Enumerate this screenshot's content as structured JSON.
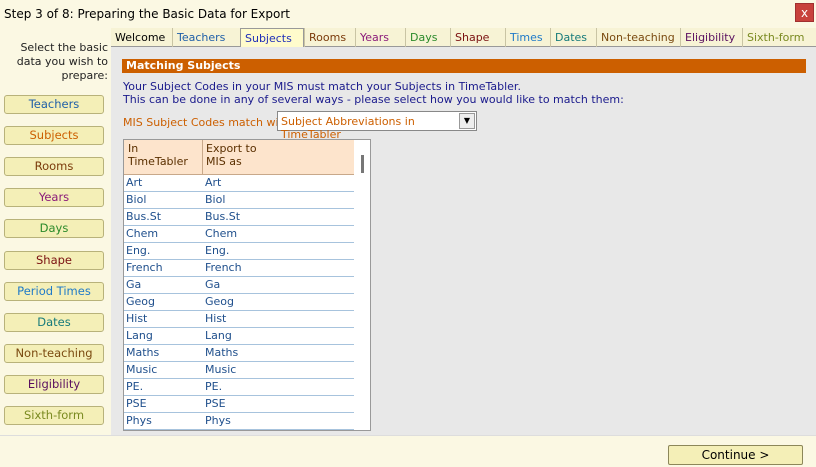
{
  "window": {
    "title": "Step 3 of 8:  Preparing the Basic Data for Export",
    "close_label": "x"
  },
  "sidebar": {
    "intro": "Select the basic data you wish to prepare:",
    "items": [
      {
        "label": "Teachers",
        "color": "#1f5fa8"
      },
      {
        "label": "Subjects",
        "color": "#cc5f00"
      },
      {
        "label": "Rooms",
        "color": "#7a3a0a"
      },
      {
        "label": "Years",
        "color": "#8b1a7a"
      },
      {
        "label": "Days",
        "color": "#2a8a2a"
      },
      {
        "label": "Shape",
        "color": "#7a1010"
      },
      {
        "label": "Period Times",
        "color": "#1f7ac8"
      },
      {
        "label": "Dates",
        "color": "#157a7a"
      },
      {
        "label": "Non-teaching",
        "color": "#7a4a10"
      },
      {
        "label": "Eligibility",
        "color": "#5a1060"
      },
      {
        "label": "Sixth-form",
        "color": "#7a8a20"
      }
    ]
  },
  "tabs": [
    {
      "label": "Welcome",
      "color": "#000000"
    },
    {
      "label": "Teachers",
      "color": "#1f5fa8"
    },
    {
      "label": "Subjects",
      "color": "#1f2fb8"
    },
    {
      "label": "Rooms",
      "color": "#7a3a0a"
    },
    {
      "label": "Years",
      "color": "#8b1a7a"
    },
    {
      "label": "Days",
      "color": "#2a8a2a"
    },
    {
      "label": "Shape",
      "color": "#7a1010"
    },
    {
      "label": "Times",
      "color": "#1f7ac8"
    },
    {
      "label": "Dates",
      "color": "#157a7a"
    },
    {
      "label": "Non-teaching",
      "color": "#7a4a10"
    },
    {
      "label": "Eligibility",
      "color": "#5a1060"
    },
    {
      "label": "Sixth-form",
      "color": "#7a8a20"
    }
  ],
  "main": {
    "section_title": "Matching Subjects",
    "instructions_line1": "Your Subject Codes in your MIS must match your Subjects in TimeTabler.",
    "instructions_line2": "This can be done in any of several ways - please select how you would like to match them:",
    "match_label": "MIS Subject Codes match with:",
    "match_value": "Subject Abbreviations in TimeTabler",
    "grid": {
      "col1_header_line1": "In",
      "col1_header_line2": "TimeTabler",
      "col2_header_line1": "Export to",
      "col2_header_line2": "MIS as",
      "rows": [
        [
          "Art",
          "Art"
        ],
        [
          "Biol",
          "Biol"
        ],
        [
          "Bus.St",
          "Bus.St"
        ],
        [
          "Chem",
          "Chem"
        ],
        [
          "Eng.",
          "Eng."
        ],
        [
          "French",
          "French"
        ],
        [
          "Ga",
          "Ga"
        ],
        [
          "Geog",
          "Geog"
        ],
        [
          "Hist",
          "Hist"
        ],
        [
          "Lang",
          "Lang"
        ],
        [
          "Maths",
          "Maths"
        ],
        [
          "Music",
          "Music"
        ],
        [
          "PE.",
          "PE."
        ],
        [
          "PSE",
          "PSE"
        ],
        [
          "Phys",
          "Phys"
        ]
      ]
    }
  },
  "footer": {
    "continue_label": "Continue >"
  }
}
